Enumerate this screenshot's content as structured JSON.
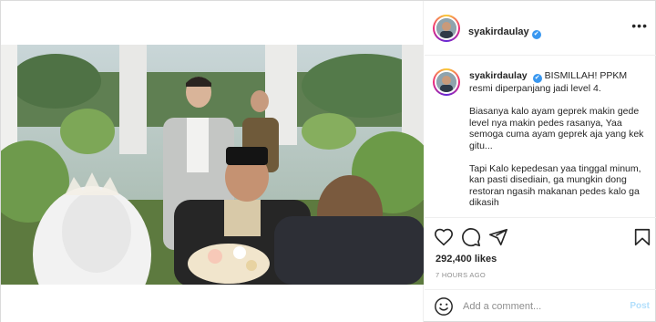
{
  "post": {
    "username": "syakirdaulay",
    "verified_symbol": "✔",
    "more_symbol": "•••",
    "caption": {
      "username": "syakirdaulay",
      "paragraphs": [
        "BISMILLAH! PPKM resmi diperpanjang jadi level 4.",
        "Biasanya kalo ayam geprek makin gede level nya makin pedes rasanya, Yaa semoga cuma ayam geprek aja yang kek gitu...",
        "Tapi Kalo kepedesan yaa tinggal minum, kan pasti disediain, ga mungkin dong restoran ngasih makanan pedes kalo ga dikasih"
      ]
    },
    "likes": "292,400 likes",
    "timestamp": "7 HOURS AGO",
    "comment": {
      "placeholder": "Add a comment...",
      "value": "",
      "post_label": "Post"
    }
  },
  "icons": {
    "like": "heart-icon",
    "comment": "comment-icon",
    "share": "share-icon",
    "save": "bookmark-icon",
    "emoji": "emoji-icon",
    "more": "more-icon"
  },
  "colors": {
    "verified": "#3897f0",
    "post_button": "#b2dffc",
    "secondary_text": "#8e8e8e",
    "border": "#efefef"
  }
}
